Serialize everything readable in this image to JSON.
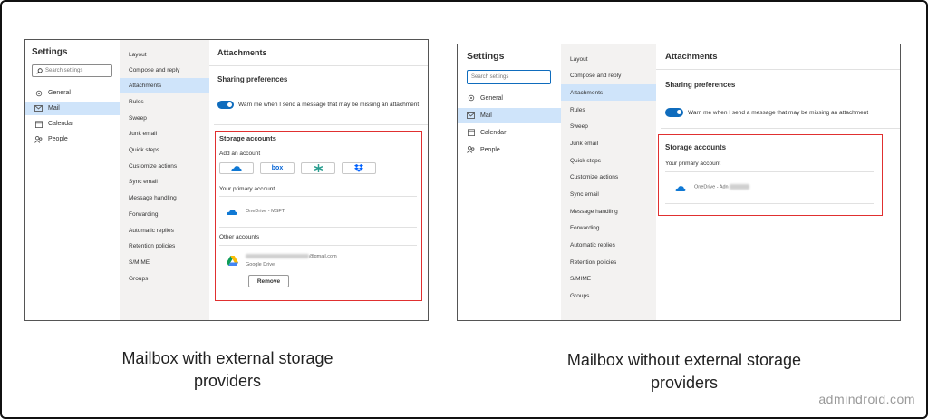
{
  "left": {
    "settings_title": "Settings",
    "search_placeholder": "Search settings",
    "nav": [
      "General",
      "Mail",
      "Calendar",
      "People"
    ],
    "subnav": [
      "Layout",
      "Compose and reply",
      "Attachments",
      "Rules",
      "Sweep",
      "Junk email",
      "Quick steps",
      "Customize actions",
      "Sync email",
      "Message handling",
      "Forwarding",
      "Automatic replies",
      "Retention policies",
      "S/MIME",
      "Groups"
    ],
    "heading": "Attachments",
    "sharing_prefs": "Sharing preferences",
    "toggle_text": "Warn me when I send a message that may be missing an attachment",
    "storage_title": "Storage accounts",
    "add_account": "Add an account",
    "providers": [
      "onedrive-icon",
      "box",
      "sharefile-icon",
      "dropbox-icon"
    ],
    "box_label": "box",
    "primary_label": "Your primary account",
    "primary_account": "OneDrive - MSFT",
    "other_label": "Other accounts",
    "other_email_suffix": "@gmail.com",
    "other_service": "Google Drive",
    "remove_label": "Remove",
    "caption_line1": "Mailbox with external storage",
    "caption_line2": "providers"
  },
  "right": {
    "settings_title": "Settings",
    "search_placeholder": "Search settings",
    "nav": [
      "General",
      "Mail",
      "Calendar",
      "People"
    ],
    "subnav": [
      "Layout",
      "Compose and reply",
      "Attachments",
      "Rules",
      "Sweep",
      "Junk email",
      "Quick steps",
      "Customize actions",
      "Sync email",
      "Message handling",
      "Forwarding",
      "Automatic replies",
      "Retention policies",
      "S/MIME",
      "Groups"
    ],
    "heading": "Attachments",
    "sharing_prefs": "Sharing preferences",
    "toggle_text": "Warn me when I send a message that may be missing an attachment",
    "storage_title": "Storage accounts",
    "primary_label": "Your primary account",
    "primary_account": "OneDrive - Adn",
    "caption_line1": "Mailbox without external storage",
    "caption_line2": "providers"
  },
  "watermark": "admindroid.com",
  "colors": {
    "accent": "#0f6cbd",
    "selected": "#cfe4fa",
    "highlight_border": "#e03030",
    "pane": "#f3f2f1"
  }
}
